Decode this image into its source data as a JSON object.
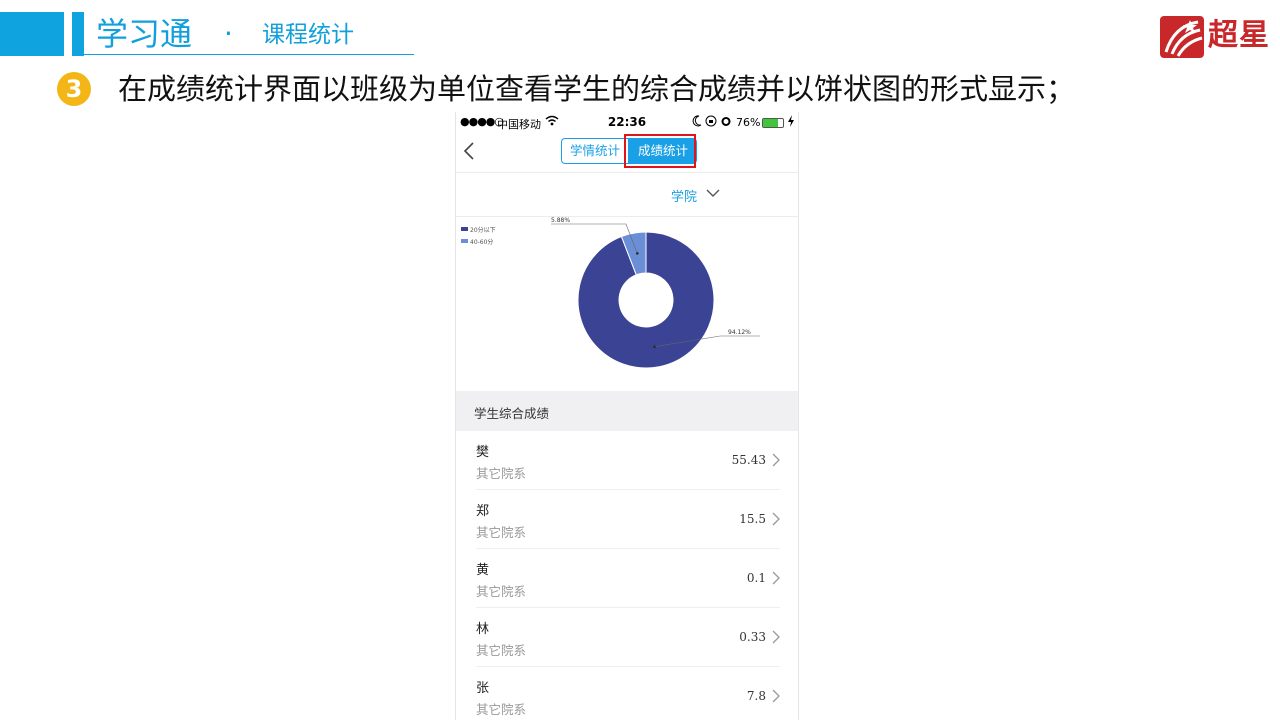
{
  "slide": {
    "title": "学习通",
    "separator": "·",
    "subtitle": "课程统计",
    "brand_name": "超星",
    "step_number": "3",
    "step_text": "在成绩统计界面以班级为单位查看学生的综合成绩并以饼状图的形式显示；",
    "accent_color": "#12a0dc",
    "brand_color": "#c8282a"
  },
  "phone": {
    "status": {
      "signal": "●●●●○",
      "carrier": "中国移动",
      "time": "22:36",
      "battery": "76%",
      "battery_level": 0.76
    },
    "nav": {
      "back_icon": "chevron-left-icon",
      "tab_learning": "学情统计",
      "tab_grades": "成绩统计",
      "active_tab": "成绩统计"
    },
    "filter": {
      "department": "学院"
    },
    "chart_data": {
      "type": "pie",
      "donut": true,
      "legend_position": "top-left",
      "legend": [
        "20分以下",
        "40-60分"
      ],
      "slices": [
        {
          "label": "20分以下",
          "value": 94.12,
          "label_text": "94.12%",
          "color": "#3b4394"
        },
        {
          "label": "40-60分",
          "value": 5.88,
          "label_text": "5.88%",
          "color": "#6b8fd6"
        }
      ]
    },
    "section_title": "学生综合成绩",
    "students": [
      {
        "name": "樊",
        "dept": "其它院系",
        "score": "55.43"
      },
      {
        "name": "郑",
        "dept": "其它院系",
        "score": "15.5"
      },
      {
        "name": "黄",
        "dept": "其它院系",
        "score": "0.1"
      },
      {
        "name": "林",
        "dept": "其它院系",
        "score": "0.33"
      },
      {
        "name": "张",
        "dept": "其它院系",
        "score": "7.8"
      }
    ]
  }
}
